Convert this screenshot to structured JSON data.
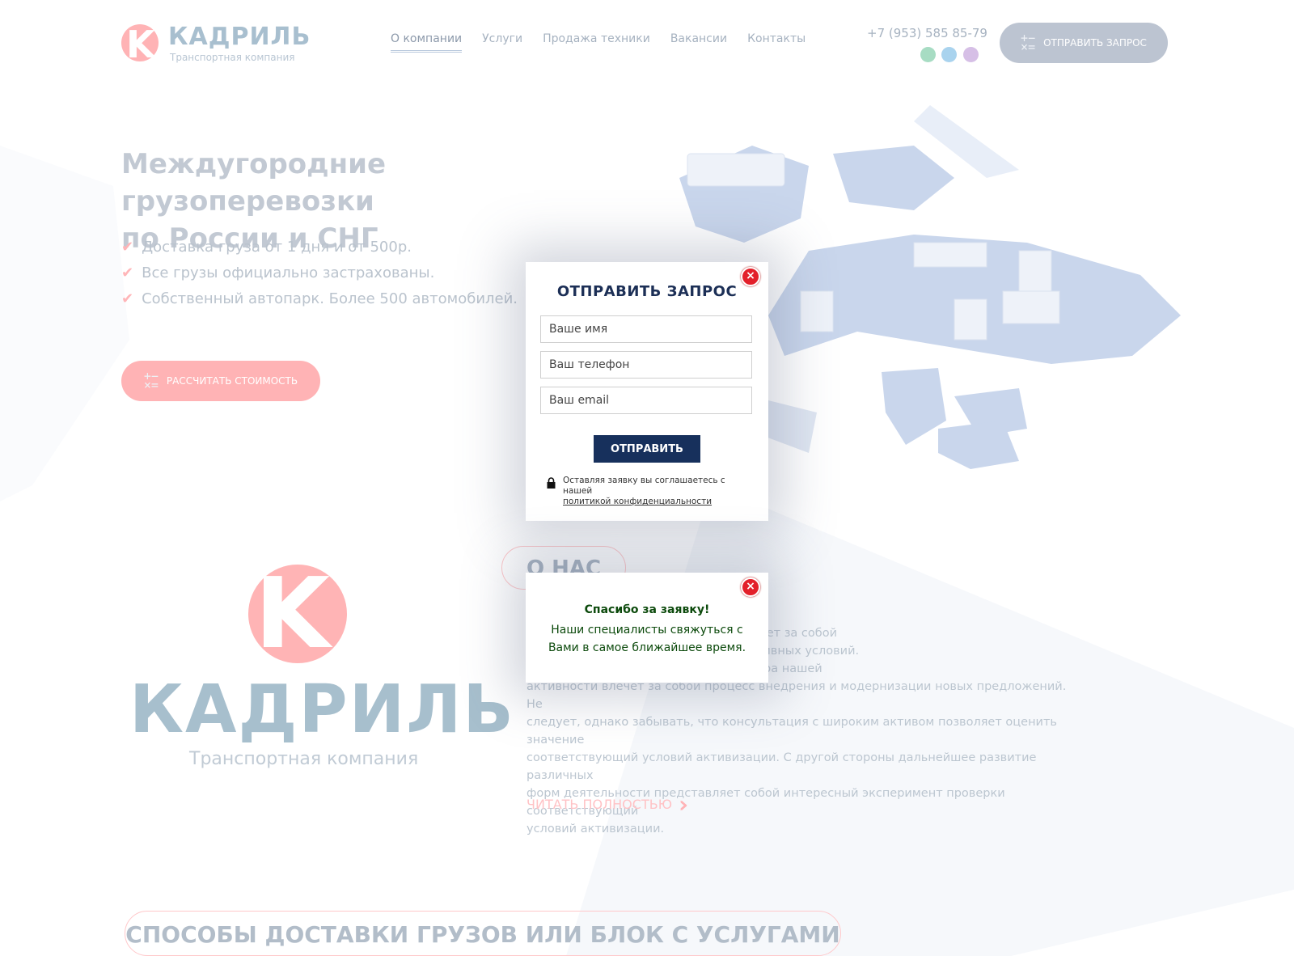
{
  "header": {
    "logo_name": "КАДРИЛЬ",
    "logo_sub": "Транспортная компания",
    "logo_letter": "K",
    "nav": [
      {
        "label": "О компании",
        "active": true
      },
      {
        "label": "Услуги"
      },
      {
        "label": "Продажа техники"
      },
      {
        "label": "Вакансии"
      },
      {
        "label": "Контакты"
      }
    ],
    "phone": "+7 (953) 585 85-79",
    "messengers": [
      "whatsapp-icon",
      "telegram-icon",
      "viber-icon"
    ],
    "request_button": "ОТПРАВИТЬ ЗАПРОС"
  },
  "hero": {
    "title_line1": "Междугородние грузоперевозки",
    "title_line2": "по России и СНГ",
    "bullets": [
      "Доставка груза от 1 дня и от 500р.",
      "Все грузы официально застрахованы.",
      "Собственный автопарк. Более 500 автомобилей."
    ],
    "calc_button": "РАССЧИТАТЬ СТОИМОСТЬ"
  },
  "about": {
    "tag": "О НАС",
    "logo_name": "КАДРИЛЬ",
    "logo_sub": "Транспортная компания",
    "text_visible_lines": [
      "крепление и развитие структуры влечет за собой",
      "ственных финансовых и административных условий.",
      "стоянный количественный рост и сфера нашей",
      "активности влечет за собой процесс внедрения и модернизации новых предложений. Не",
      "следует, однако забывать, что консультация с широким активом позволяет оценить значение",
      "соответствующий условий активизации. С другой стороны дальнейшее развитие различных",
      "форм деятельности представляет собой интересный эксперимент проверки соответствующий",
      "условий активизации."
    ],
    "read_more": "ЧИТАТЬ ПОЛНОСТЬЮ"
  },
  "services": {
    "heading": "СПОСОБЫ ДОСТАВКИ ГРУЗОВ ИЛИ БЛОК С УСЛУГАМИ"
  },
  "request_modal": {
    "title": "ОТПРАВИТЬ ЗАПРОС",
    "name_placeholder": "Ваше имя",
    "phone_placeholder": "Ваш телефон",
    "email_placeholder": "Ваш email",
    "submit": "ОТПРАВИТЬ",
    "consent_text": "Оставляя заявку вы соглашаетесь с нашей",
    "consent_link": "политикой конфиденциальности"
  },
  "thanks_modal": {
    "title": "Спасибо за заявку!",
    "line1": "Наши специалисты свяжуться с",
    "line2": "Вами в самое ближайшее время."
  },
  "colors": {
    "accent_pink": "#ffb3b5",
    "navy": "#17305c",
    "close_red": "#e3202a",
    "thanks_green": "#0c4a0c"
  }
}
